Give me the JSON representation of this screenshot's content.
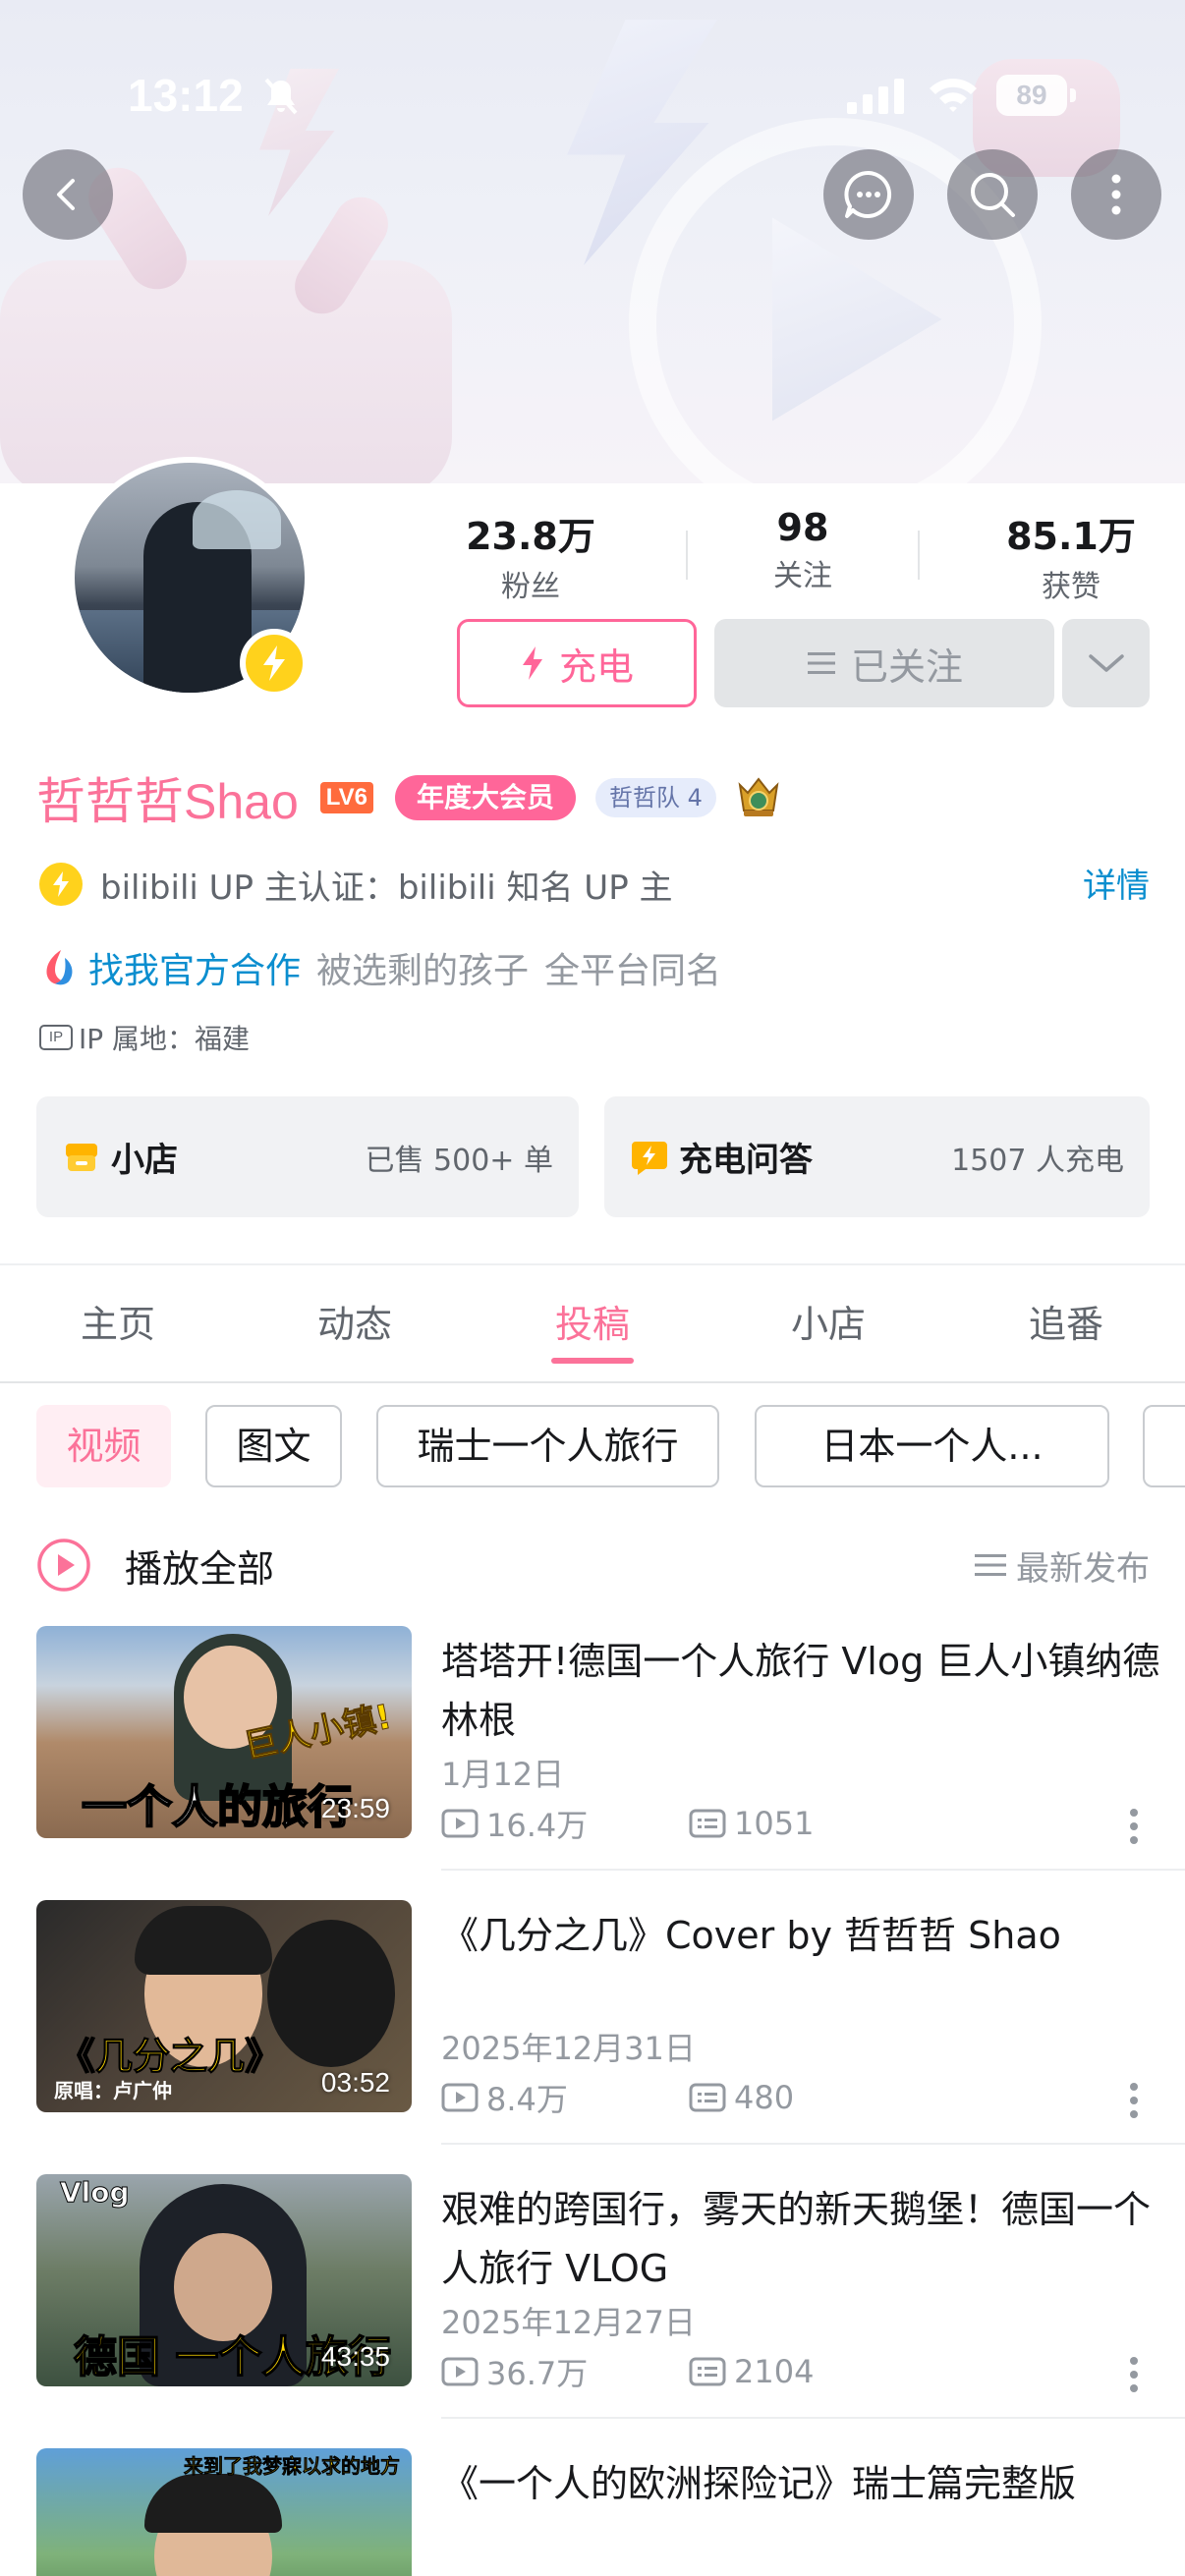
{
  "status_bar": {
    "time": "13:12",
    "battery": "89"
  },
  "profile": {
    "stats": [
      {
        "value": "23.8万",
        "label": "粉丝"
      },
      {
        "value": "98",
        "label": "关注"
      },
      {
        "value": "85.1万",
        "label": "获赞"
      }
    ],
    "charge_label": "充电",
    "followed_label": "已关注",
    "username": "哲哲哲Shao",
    "level": "LV6",
    "vip_badge": "年度大会员",
    "fan_badge": "哲哲队",
    "fan_badge_level": "4",
    "auth_text": "bilibili UP 主认证：bilibili 知名 UP 主",
    "detail_link": "详情",
    "coop_link": "找我官方合作",
    "coop_text1": "被选剩的孩子",
    "coop_text2": "全平台同名",
    "ip_label": "IP",
    "ip_text": "IP 属地：福建"
  },
  "cards": {
    "shop": {
      "title": "小店",
      "value": "已售 500+ 单"
    },
    "qa": {
      "title": "充电问答",
      "value": "1507 人充电"
    }
  },
  "tabs": [
    {
      "label": "主页"
    },
    {
      "label": "动态"
    },
    {
      "label": "投稿",
      "active": true
    },
    {
      "label": "小店"
    },
    {
      "label": "追番"
    }
  ],
  "chips": [
    {
      "label": "视频",
      "active": true
    },
    {
      "label": "图文"
    },
    {
      "label": "瑞士一个人旅行"
    },
    {
      "label": "日本一个人..."
    },
    {
      "label": ""
    }
  ],
  "play_all": {
    "label": "播放全部",
    "sort_label": "最新发布"
  },
  "videos": [
    {
      "title": "塔塔开!德国一个人旅行 Vlog 巨人小镇纳德林根",
      "date": "1月12日",
      "plays": "16.4万",
      "comments": "1051",
      "duration": "23:59",
      "overlay_main": "一个人的旅行",
      "overlay_sub": "巨人小镇!"
    },
    {
      "title": "《几分之几》Cover by 哲哲哲 Shao",
      "date": "2025年12月31日",
      "plays": "8.4万",
      "comments": "480",
      "duration": "03:52",
      "overlay_main": "《几分之几》",
      "overlay_sub": "原唱：卢广仲"
    },
    {
      "title": "艰难的跨国行，雾天的新天鹅堡！德国一个人旅行 VLOG",
      "date": "2025年12月27日",
      "plays": "36.7万",
      "comments": "2104",
      "duration": "43:35",
      "overlay_main": "德国 一个人旅行",
      "overlay_sub": "Vlog"
    },
    {
      "title": "《一个人的欧洲探险记》瑞士篇完整版",
      "overlay_sub": "来到了我梦寐以求的地方"
    }
  ],
  "colors": {
    "brand_pink": "#fb7299",
    "link_blue": "#0b8ecf",
    "level_orange": "#ff6b3d",
    "badge_yellow": "#ffd21c"
  }
}
